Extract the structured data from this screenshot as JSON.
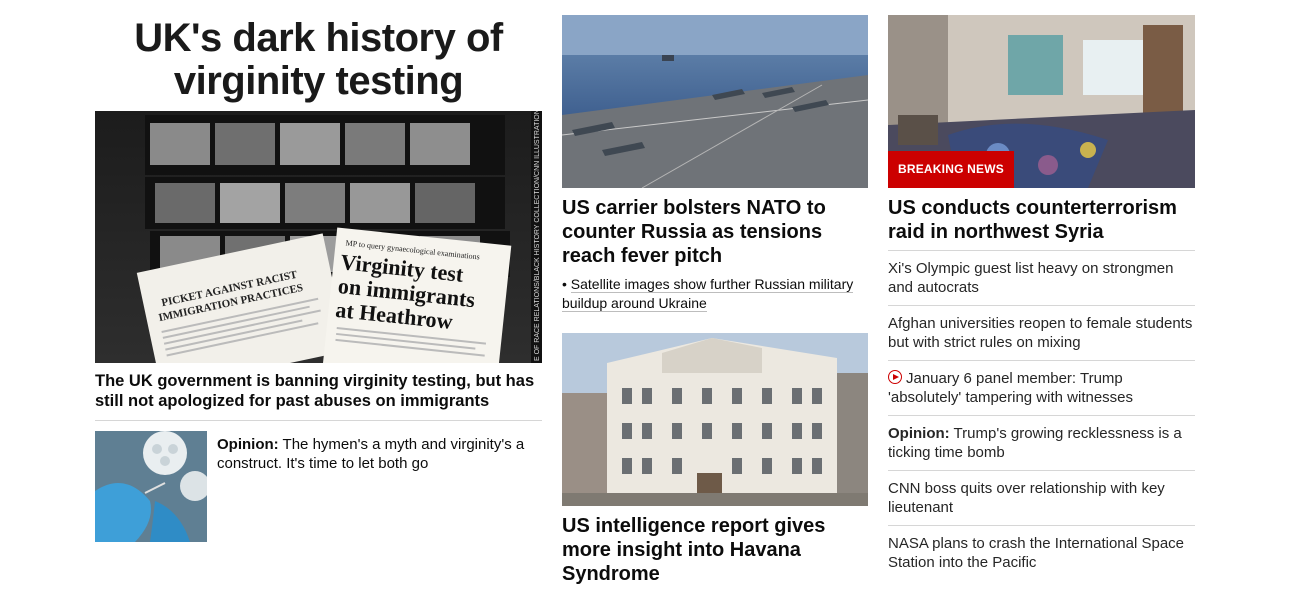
{
  "lead": {
    "title": "UK's dark history of virginity testing",
    "image_alt": "Contact sheet and newspaper clippings",
    "image_texts": {
      "picket": "PICKET AGAINST RACIST IMMIGRATION PRACTICES",
      "clip_header": "MP to query gynaecological examinations",
      "clip_headline": "Virginity test on immigrants at Heathrow",
      "credit": "E OF RACE RELATIONS/BLACK HISTORY COLLECTION/CNN ILLUSTRATION"
    },
    "caption": "The UK government is banning virginity testing, but has still not apologized for past abuses on immigrants",
    "opinion": {
      "label": "Opinion:",
      "text": " The hymen's a myth and virginity's a construct. It's time to let both go"
    }
  },
  "middle": {
    "card1": {
      "headline": "US carrier bolsters NATO to counter Russia as tensions reach fever pitch",
      "bullet": "Satellite images show further Russian military buildup around Ukraine"
    },
    "card2": {
      "headline": "US intelligence report gives more insight into Havana Syndrome"
    }
  },
  "right": {
    "badge": "BREAKING NEWS",
    "headline": "US conducts counterterrorism raid in northwest Syria",
    "list": [
      {
        "text": "Xi's Olympic guest list heavy on strongmen and autocrats"
      },
      {
        "text": "Afghan universities reopen to female students but with strict rules on mixing"
      },
      {
        "text": "January 6 panel member: Trump 'absolutely' tampering with witnesses",
        "icon": "play-icon"
      },
      {
        "label": "Opinion:",
        "text": " Trump's growing recklessness is a ticking time bomb"
      },
      {
        "text": "CNN boss quits over relationship with key lieutenant"
      },
      {
        "text": "NASA plans to crash the International Space Station into the Pacific"
      }
    ]
  },
  "colors": {
    "breaking": "#cc0000",
    "divider": "#d6d6d6"
  }
}
